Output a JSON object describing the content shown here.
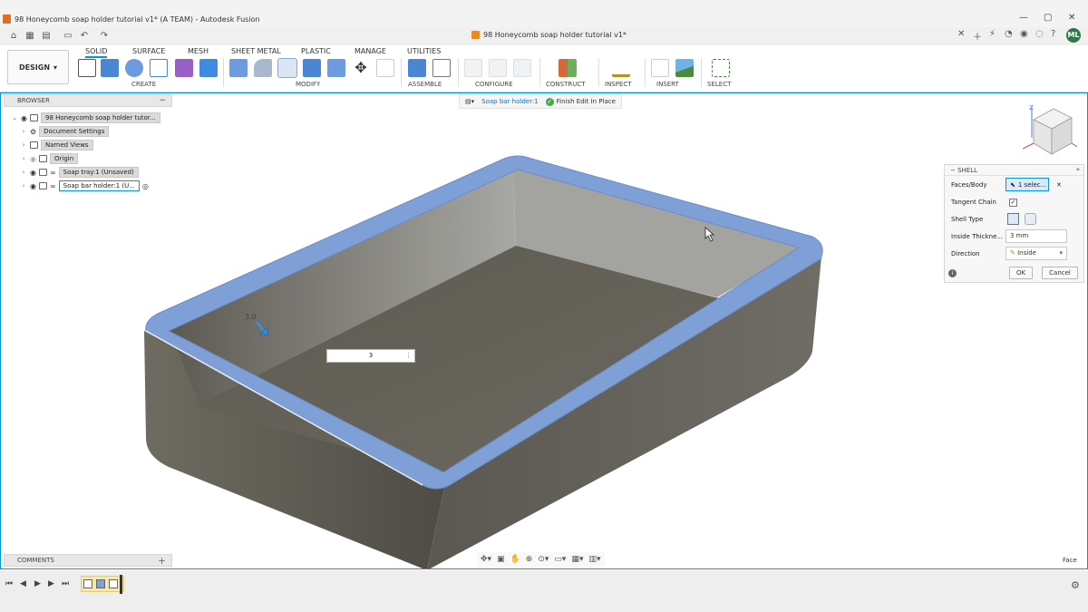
{
  "window": {
    "title": "98 Honeycomb soap holder tutorial v1* (A TEAM) - Autodesk Fusion",
    "controls": [
      "—",
      "▢",
      "✕"
    ]
  },
  "document_tab": {
    "label": "98 Honeycomb soap holder tutorial v1*",
    "close": "✕"
  },
  "user": {
    "initials": "ML"
  },
  "ribbon": {
    "workspace": "DESIGN",
    "tabs": [
      "SOLID",
      "SURFACE",
      "MESH",
      "SHEET METAL",
      "PLASTIC",
      "MANAGE",
      "UTILITIES"
    ],
    "active_tab": "SOLID",
    "groups": [
      "CREATE",
      "MODIFY",
      "ASSEMBLE",
      "CONFIGURE",
      "CONSTRUCT",
      "INSPECT",
      "INSERT",
      "SELECT"
    ]
  },
  "browser": {
    "title": "BROWSER",
    "items": [
      {
        "label": "98 Honeycomb soap holder tutor..."
      },
      {
        "label": "Document Settings"
      },
      {
        "label": "Named Views"
      },
      {
        "label": "Origin"
      },
      {
        "label": "Soap tray:1 (Unsaved)"
      },
      {
        "label": "Soap bar holder:1 (U..."
      }
    ]
  },
  "edit_in_place": {
    "component": "Soap bar holder:1",
    "finish": "Finish Edit In Place"
  },
  "shell_dialog": {
    "title": "SHELL",
    "faces_body_label": "Faces/Body",
    "faces_body_value": "1 selec...",
    "tangent_chain_label": "Tangent Chain",
    "tangent_chain_checked": "✓",
    "shell_type_label": "Shell Type",
    "inside_thickness_label": "Inside Thickne...",
    "inside_thickness_value": "3 mm",
    "direction_label": "Direction",
    "direction_value": "Inside",
    "ok": "OK",
    "cancel": "Cancel"
  },
  "canvas": {
    "thickness_input": "3",
    "dimension_label": "3.0",
    "selection_filter": "Face"
  },
  "comments": {
    "title": "COMMENTS"
  },
  "colors": {
    "accent": "#0696d7",
    "shell_face": "#7fa0d6",
    "body": "#6d6a60",
    "avatar": "#2c7a43"
  }
}
